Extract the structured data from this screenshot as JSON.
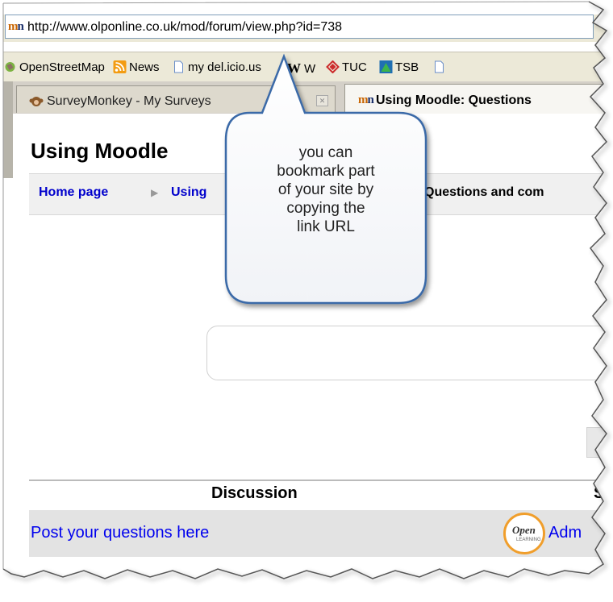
{
  "browser": {
    "url": "http://www.olponline.co.uk/mod/forum/view.php?id=738",
    "bookmarks": [
      {
        "label": "OpenStreetMap",
        "icon": "openstreetmap-icon"
      },
      {
        "label": "News",
        "icon": "rss-feed-icon"
      },
      {
        "label": "my del.icio.us",
        "icon": "page-icon"
      },
      {
        "label": "W",
        "icon": "wikipedia-icon"
      },
      {
        "label": "TUC",
        "icon": "tuc-icon"
      },
      {
        "label": "TSB",
        "icon": "tsb-icon"
      }
    ],
    "tabs": [
      {
        "label": "SurveyMonkey - My Surveys",
        "active": false
      },
      {
        "label": "Using Moodle: Questions",
        "active": true
      }
    ]
  },
  "page": {
    "title": "Using Moodle",
    "breadcrumb": [
      "Home page",
      "Using",
      "Questions and com"
    ]
  },
  "forum_table": {
    "columns": [
      "Discussion",
      "St"
    ],
    "rows": [
      {
        "discussion": "Post your questions here",
        "author": "Adm"
      }
    ]
  },
  "callout": {
    "lines": [
      "you can",
      "bookmark part",
      "of your site by",
      "copying the",
      "link URL"
    ]
  },
  "colors": {
    "link": "#0000ee",
    "breadcrumb": "#0000cc",
    "chrome": "#ece9d8",
    "logo_ring": "#f09e2b"
  }
}
